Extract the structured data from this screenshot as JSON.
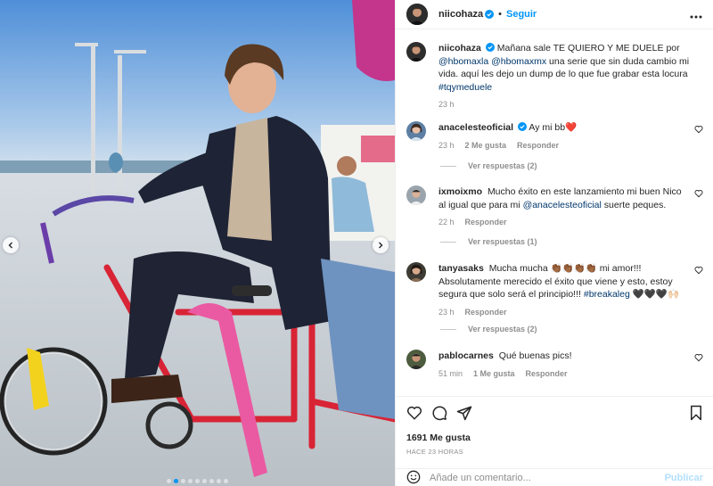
{
  "post": {
    "author": "niicohaza",
    "follow_label": "Seguir",
    "separator": "•",
    "caption_text": "Mañana sale TE QUIERO Y ME DUELE por",
    "caption_mention1": "@hbomaxla",
    "caption_mention2": "@hbomaxmx",
    "caption_rest": "una serie que sin duda cambio mi vida. aquí les dejo un dump de lo que fue grabar esta locura",
    "caption_tag": "#tqymeduele",
    "caption_time": "23 h",
    "likes": "1691 Me gusta",
    "posted_ago": "HACE 23 HORAS",
    "comment_placeholder": "Añade un comentario...",
    "post_label": "Publicar",
    "carousel": {
      "total": 9,
      "active": 1
    }
  },
  "comments": [
    {
      "user": "anacelesteoficial",
      "text": "Ay mi bb",
      "emoji": "❤️",
      "time": "23 h",
      "likes": "2 Me gusta",
      "reply": "Responder",
      "view_replies": "Ver respuestas (2)"
    },
    {
      "user": "ixmoixmo",
      "text": "Mucho éxito en este lanzamiento mi buen Nico al igual que para mi",
      "mention": "@anacelesteoficial",
      "text_after": "suerte peques.",
      "time": "22 h",
      "reply": "Responder",
      "view_replies": "Ver respuestas (1)"
    },
    {
      "user": "tanyasaks",
      "text": "Mucha mucha 👏🏾👏🏾👏🏾👏🏾 mi amor!!! Absolutamente merecido el éxito que viene y esto, estoy segura que solo será el principio!!!",
      "tag": "#breakaleg",
      "text_after": "🖤🖤🖤🙌🏻",
      "time": "23 h",
      "reply": "Responder",
      "view_replies": "Ver respuestas (2)"
    },
    {
      "user": "pablocarnes",
      "text": "Qué buenas pics!",
      "time": "51 min",
      "likes": "1 Me gusta",
      "reply": "Responder"
    }
  ],
  "icons": {
    "like": "heart-icon",
    "comment": "comment-icon",
    "share": "paper-plane-icon",
    "save": "bookmark-icon",
    "more": "more-horizontal-icon",
    "emoji": "smiley-icon",
    "verified": "verified-badge-icon",
    "prev": "chevron-left-icon",
    "next": "chevron-right-icon"
  },
  "colors": {
    "accent": "#0095f6",
    "link": "#00376b",
    "secondary_text": "#8e8e8e",
    "heart": "#ed4956"
  }
}
